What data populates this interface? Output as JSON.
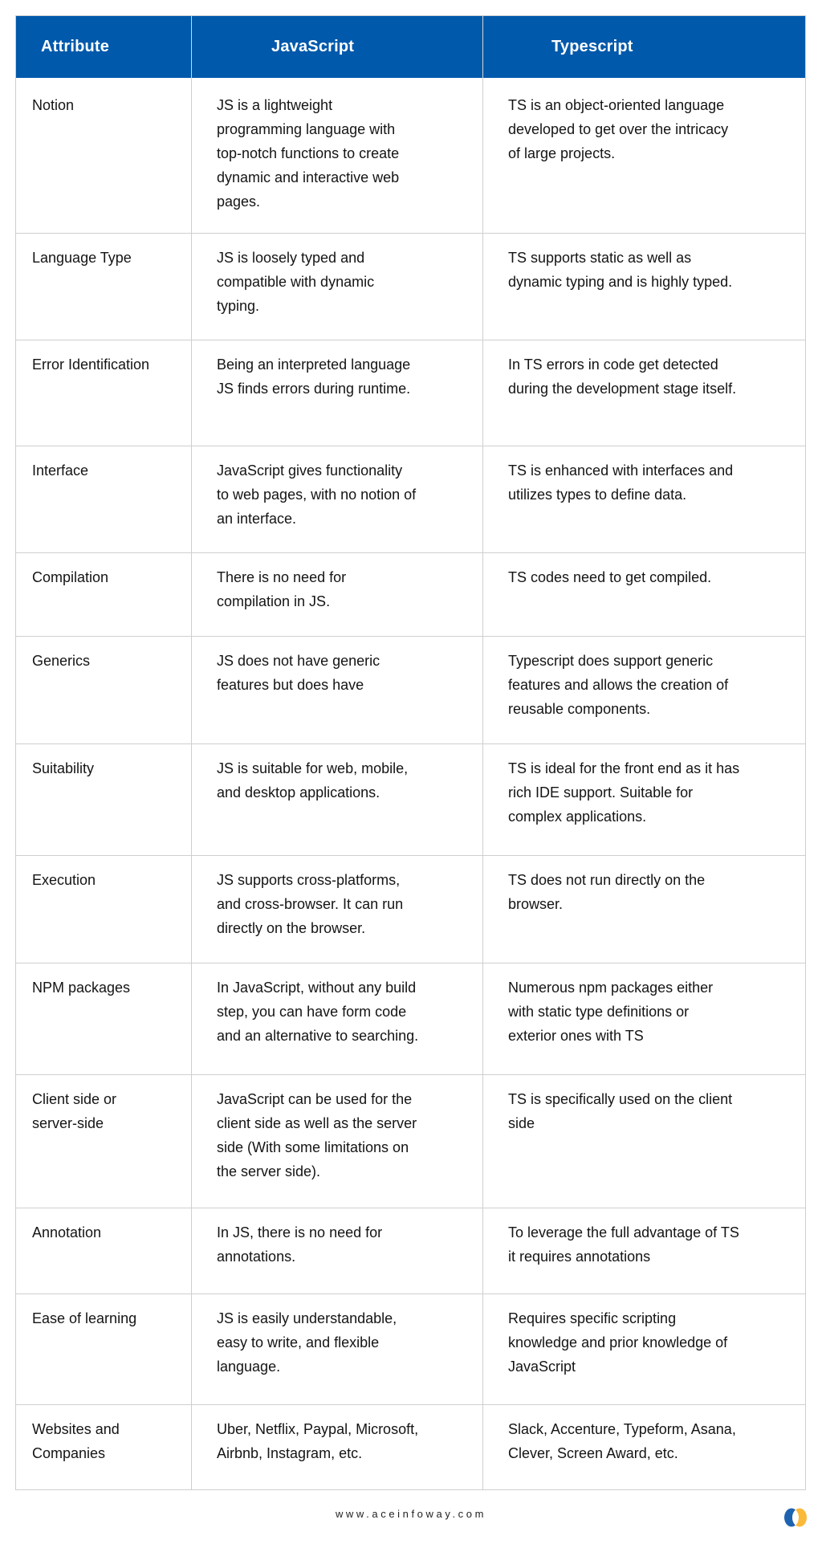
{
  "table": {
    "headers": [
      "Attribute",
      "JavaScript",
      "Typescript"
    ],
    "rows": [
      {
        "attribute": [
          "Notion"
        ],
        "javascript": [
          "JS is a lightweight",
          "programming language with",
          "top-notch functions to create",
          "dynamic and interactive web",
          "pages."
        ],
        "typescript": [
          "TS is an object-oriented language",
          "developed to get over the intricacy",
          "of large projects."
        ]
      },
      {
        "attribute": [
          "Language Type"
        ],
        "javascript": [
          "JS is loosely typed and",
          "compatible with dynamic",
          "typing."
        ],
        "typescript": [
          "TS supports static as well as",
          "dynamic typing and is highly typed."
        ]
      },
      {
        "attribute": [
          "Error Identification"
        ],
        "javascript": [
          "Being an interpreted language",
          "JS finds errors during runtime."
        ],
        "typescript": [
          "In TS errors in code get detected",
          "during the development stage itself."
        ]
      },
      {
        "attribute": [
          "Interface"
        ],
        "javascript": [
          "JavaScript gives functionality",
          "to web pages, with no notion of",
          "an interface."
        ],
        "typescript": [
          "TS is enhanced with interfaces and",
          "utilizes types to define data."
        ]
      },
      {
        "attribute": [
          "Compilation"
        ],
        "javascript": [
          "There is no need for",
          "compilation in JS."
        ],
        "typescript": [
          "TS codes need to get compiled."
        ]
      },
      {
        "attribute": [
          "Generics"
        ],
        "javascript": [
          "JS does not have generic",
          "features but does have"
        ],
        "typescript": [
          "Typescript does support generic",
          "features and allows the creation of",
          "reusable components."
        ]
      },
      {
        "attribute": [
          "Suitability"
        ],
        "javascript": [
          "JS is suitable for web, mobile,",
          "and desktop applications."
        ],
        "typescript": [
          "TS is ideal for the front end as it has",
          "rich IDE support. Suitable for",
          "complex applications."
        ]
      },
      {
        "attribute": [
          "Execution"
        ],
        "javascript": [
          "JS supports cross-platforms,",
          "and cross-browser. It can run",
          "directly on the browser."
        ],
        "typescript": [
          "TS does not run directly on the",
          "browser."
        ]
      },
      {
        "attribute": [
          "NPM packages"
        ],
        "javascript": [
          "In JavaScript, without any build",
          "step, you can have form code",
          "and an alternative to searching."
        ],
        "typescript": [
          "Numerous npm packages either",
          "with static type definitions or",
          "exterior ones with TS"
        ]
      },
      {
        "attribute": [
          "Client side or",
          "server-side"
        ],
        "javascript": [
          "JavaScript can be used for the",
          "client side as well as the server",
          "side (With some limitations on",
          "the server side)."
        ],
        "typescript": [
          "TS is specifically used on the client",
          "side"
        ]
      },
      {
        "attribute": [
          "Annotation"
        ],
        "javascript": [
          "In JS, there is no need for",
          "annotations."
        ],
        "typescript": [
          "To leverage the full advantage of TS",
          "it requires annotations"
        ]
      },
      {
        "attribute": [
          "Ease of learning"
        ],
        "javascript": [
          "JS is easily understandable,",
          "easy to write, and flexible",
          "language."
        ],
        "typescript": [
          "Requires specific scripting",
          "knowledge and prior knowledge of",
          "JavaScript"
        ]
      },
      {
        "attribute": [
          "Websites and",
          "Companies"
        ],
        "javascript": [
          "Uber, Netflix, Paypal, Microsoft,",
          "Airbnb, Instagram, etc."
        ],
        "typescript": [
          "Slack, Accenture, Typeform, Asana,",
          "Clever, Screen Award, etc."
        ]
      }
    ]
  },
  "footer": {
    "website": "www.aceinfoway.com",
    "logo_icon": "aceinfoway-logo-icon"
  },
  "colors": {
    "header_bg": "#0059ab",
    "header_text": "#ffffff",
    "border": "#cfcfcf",
    "logo_blue": "#1e63b0",
    "logo_yellow": "#fbb93a"
  }
}
